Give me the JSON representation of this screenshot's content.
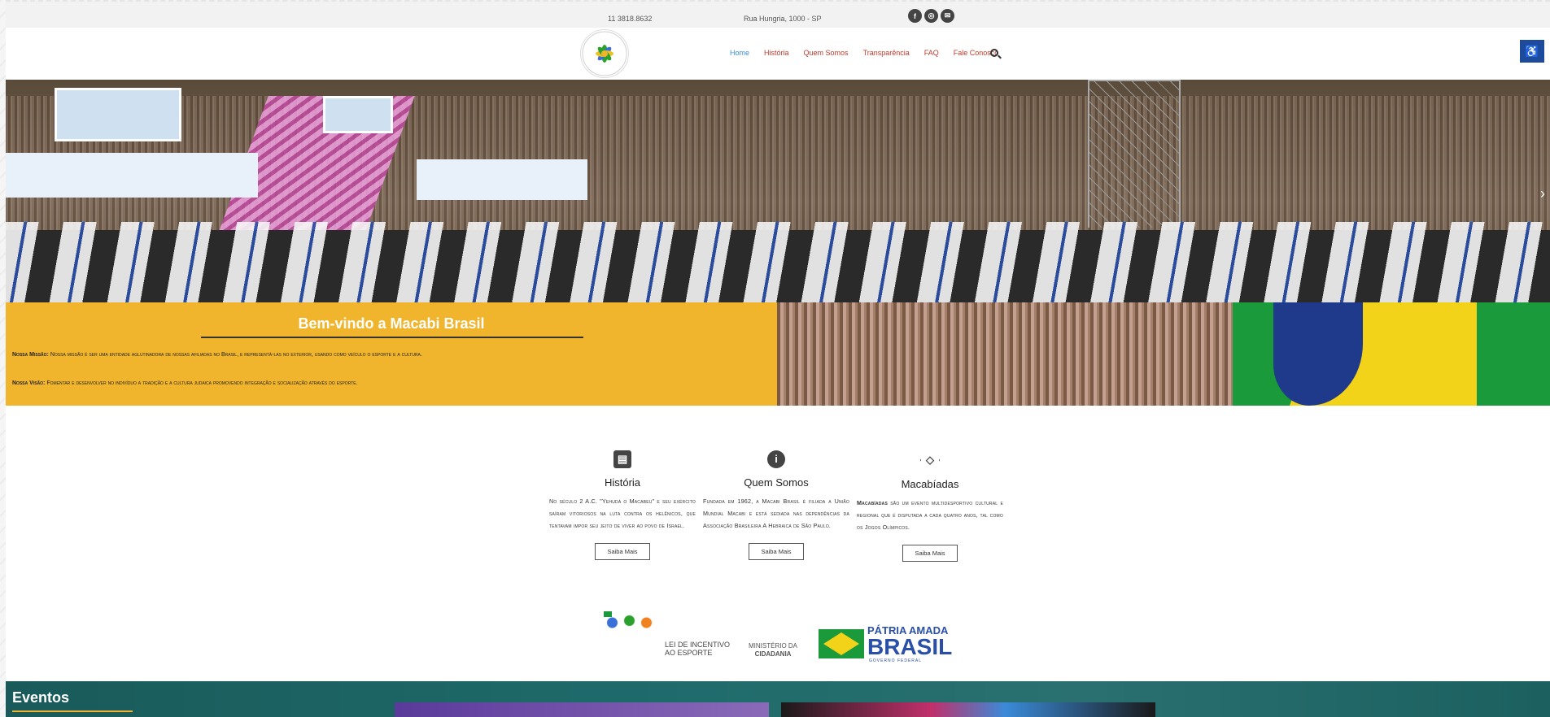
{
  "topbar": {
    "phone": "11 3818.8632",
    "address": "Rua Hungria, 1000 - SP",
    "social_icons": [
      "facebook-icon",
      "instagram-icon",
      "mail-icon"
    ]
  },
  "nav": {
    "items": [
      {
        "label": "Home",
        "active": true
      },
      {
        "label": "História"
      },
      {
        "label": "Quem Somos"
      },
      {
        "label": "Transparência"
      },
      {
        "label": "FAQ"
      },
      {
        "label": "Fale Conosco"
      }
    ]
  },
  "welcome": {
    "title": "Bem-vindo a Macabi Brasil",
    "mission_label": "Nossa Missão:",
    "mission_text": "Nossa missão é ser uma entidade aglutinadora de nossas afiliadas no Brasil, e representá-las no exterior, usando como veículo o esporte e a cultura.",
    "vision_label": "Nossa Visão:",
    "vision_text": "Fomentar e desenvolver no indivíduo a tradição e a cultura judaica promovendo integração e socialização através do esporte."
  },
  "features": [
    {
      "icon": "book-icon",
      "title": "História",
      "text": "No século 2 A.C. \"Yehudá o Macabeu\" e seu exército saíram vitoriosos na luta contra os helênicos, que tentavam impor seu jeito de viver ao povo de Israel.",
      "button": "Saiba Mais"
    },
    {
      "icon": "info-icon",
      "title": "Quem Somos",
      "text": "Fundada em 1962, a Macabi Brasil é filiada a União Mundial Macabi e está sediada nas dependências da Associação Brasileira A Hebraica de São Paulo.",
      "button": "Saiba Mais"
    },
    {
      "icon": "hexagon-icon",
      "title": "Macabíadas",
      "text_bold": "Macabíadas",
      "text": " são um evento multidesportivo cultural e regional que é disputada a cada quatro anos, tal como os Jogos Olímpicos.",
      "button": "Saiba Mais"
    }
  ],
  "sponsors": {
    "lei_line1": "LEI DE INCENTIVO",
    "lei_line2": "AO ESPORTE",
    "ministerio_line1": "MINISTÉRIO DA",
    "ministerio_line2": "CIDADANIA",
    "patria_line1": "PÁTRIA AMADA",
    "patria_line2": "BRASIL",
    "patria_line3": "GOVERNO FEDERAL"
  },
  "events": {
    "title": "Eventos"
  },
  "colors": {
    "accent_yellow": "#f0b42d",
    "nav_red": "#c0392b",
    "nav_active_blue": "#3a8fd8",
    "accessibility_blue": "#1e4a9c"
  }
}
